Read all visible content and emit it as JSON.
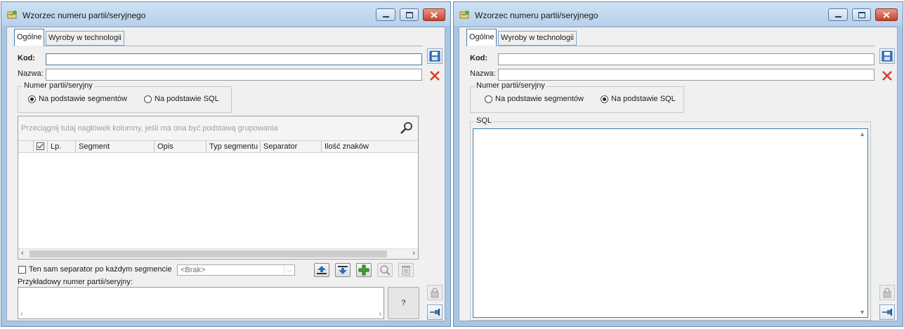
{
  "left": {
    "title": "Wzorzec numeru partii/seryjnego",
    "tabs": [
      "Ogólne",
      "Wyroby w technologii"
    ],
    "kod_label": "Kod:",
    "nazwa_label": "Nazwa:",
    "group_label": "Numer partii/seryjny",
    "radio1": "Na podstawie segmentów",
    "radio2": "Na podstawie SQL",
    "selected_radio": "radio1",
    "grid_hint": "Przeciągnij tutaj nagłówek kolumny, jeśli ma ona być podstawą grupowania",
    "columns": [
      "Lp.",
      "Segment",
      "Opis",
      "Typ segmentu",
      "Separator",
      "Ilość znaków"
    ],
    "same_separator_label": "Ten sam separator po każdym segmencie",
    "separator_value": "<Brak>",
    "example_label": "Przykładowy numer partii/seryjny:",
    "question_button": "?"
  },
  "right": {
    "title": "Wzorzec numeru partii/seryjnego",
    "tabs": [
      "Ogólne",
      "Wyroby w technologii"
    ],
    "kod_label": "Kod:",
    "nazwa_label": "Nazwa:",
    "group_label": "Numer partii/seryjny",
    "radio1": "Na podstawie segmentów",
    "radio2": "Na podstawie SQL",
    "selected_radio": "radio2",
    "sql_label": "SQL"
  },
  "icons": {
    "save": "floppy-disk-icon",
    "cancel": "red-x-icon",
    "lock": "padlock-icon",
    "pin": "pin-icon",
    "search": "magnifier-icon",
    "move_up": "move-up-icon",
    "move_down": "move-down-icon",
    "add": "green-plus-icon",
    "zoom": "zoom-icon",
    "delete": "trash-icon"
  },
  "colors": {
    "window_frame": "#a9c6e4",
    "close_button": "#c4432a",
    "focus_border": "#3c7fb1",
    "add_green": "#3aa52b"
  }
}
